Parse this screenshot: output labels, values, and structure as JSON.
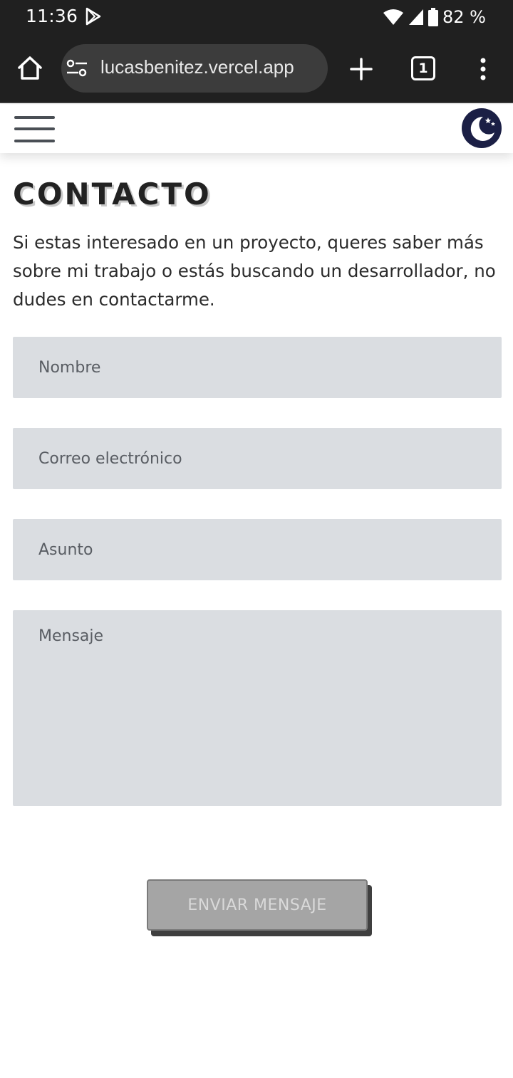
{
  "status_bar": {
    "time": "11:36",
    "battery": "82 %",
    "icons": [
      "play-store-icon",
      "wifi-icon",
      "signal-icon",
      "battery-icon"
    ]
  },
  "browser": {
    "url": "lucasbenitez.vercel.app",
    "tab_count": "1",
    "icons": [
      "home-icon",
      "site-settings-icon",
      "new-tab-icon",
      "tabs-icon",
      "more-vert-icon"
    ]
  },
  "site_header": {
    "icons": [
      "hamburger-menu-icon",
      "moon-stars-icon"
    ]
  },
  "contact": {
    "title": "CONTACTO",
    "intro": "Si estas interesado en un proyecto, queres saber más sobre mi trabajo o estás buscando un desarrollador, no dudes en contactarme.",
    "form": {
      "name_placeholder": "Nombre",
      "email_placeholder": "Correo electrónico",
      "subject_placeholder": "Asunto",
      "message_placeholder": "Mensaje",
      "submit_label": "ENVIAR MENSAJE"
    }
  },
  "colors": {
    "status_bar_bg": "#202020",
    "url_pill_bg": "#3c3c3c",
    "field_bg": "#dadde1",
    "toggle_bg": "#1b1f45",
    "button_bg": "#a5a5a5"
  }
}
